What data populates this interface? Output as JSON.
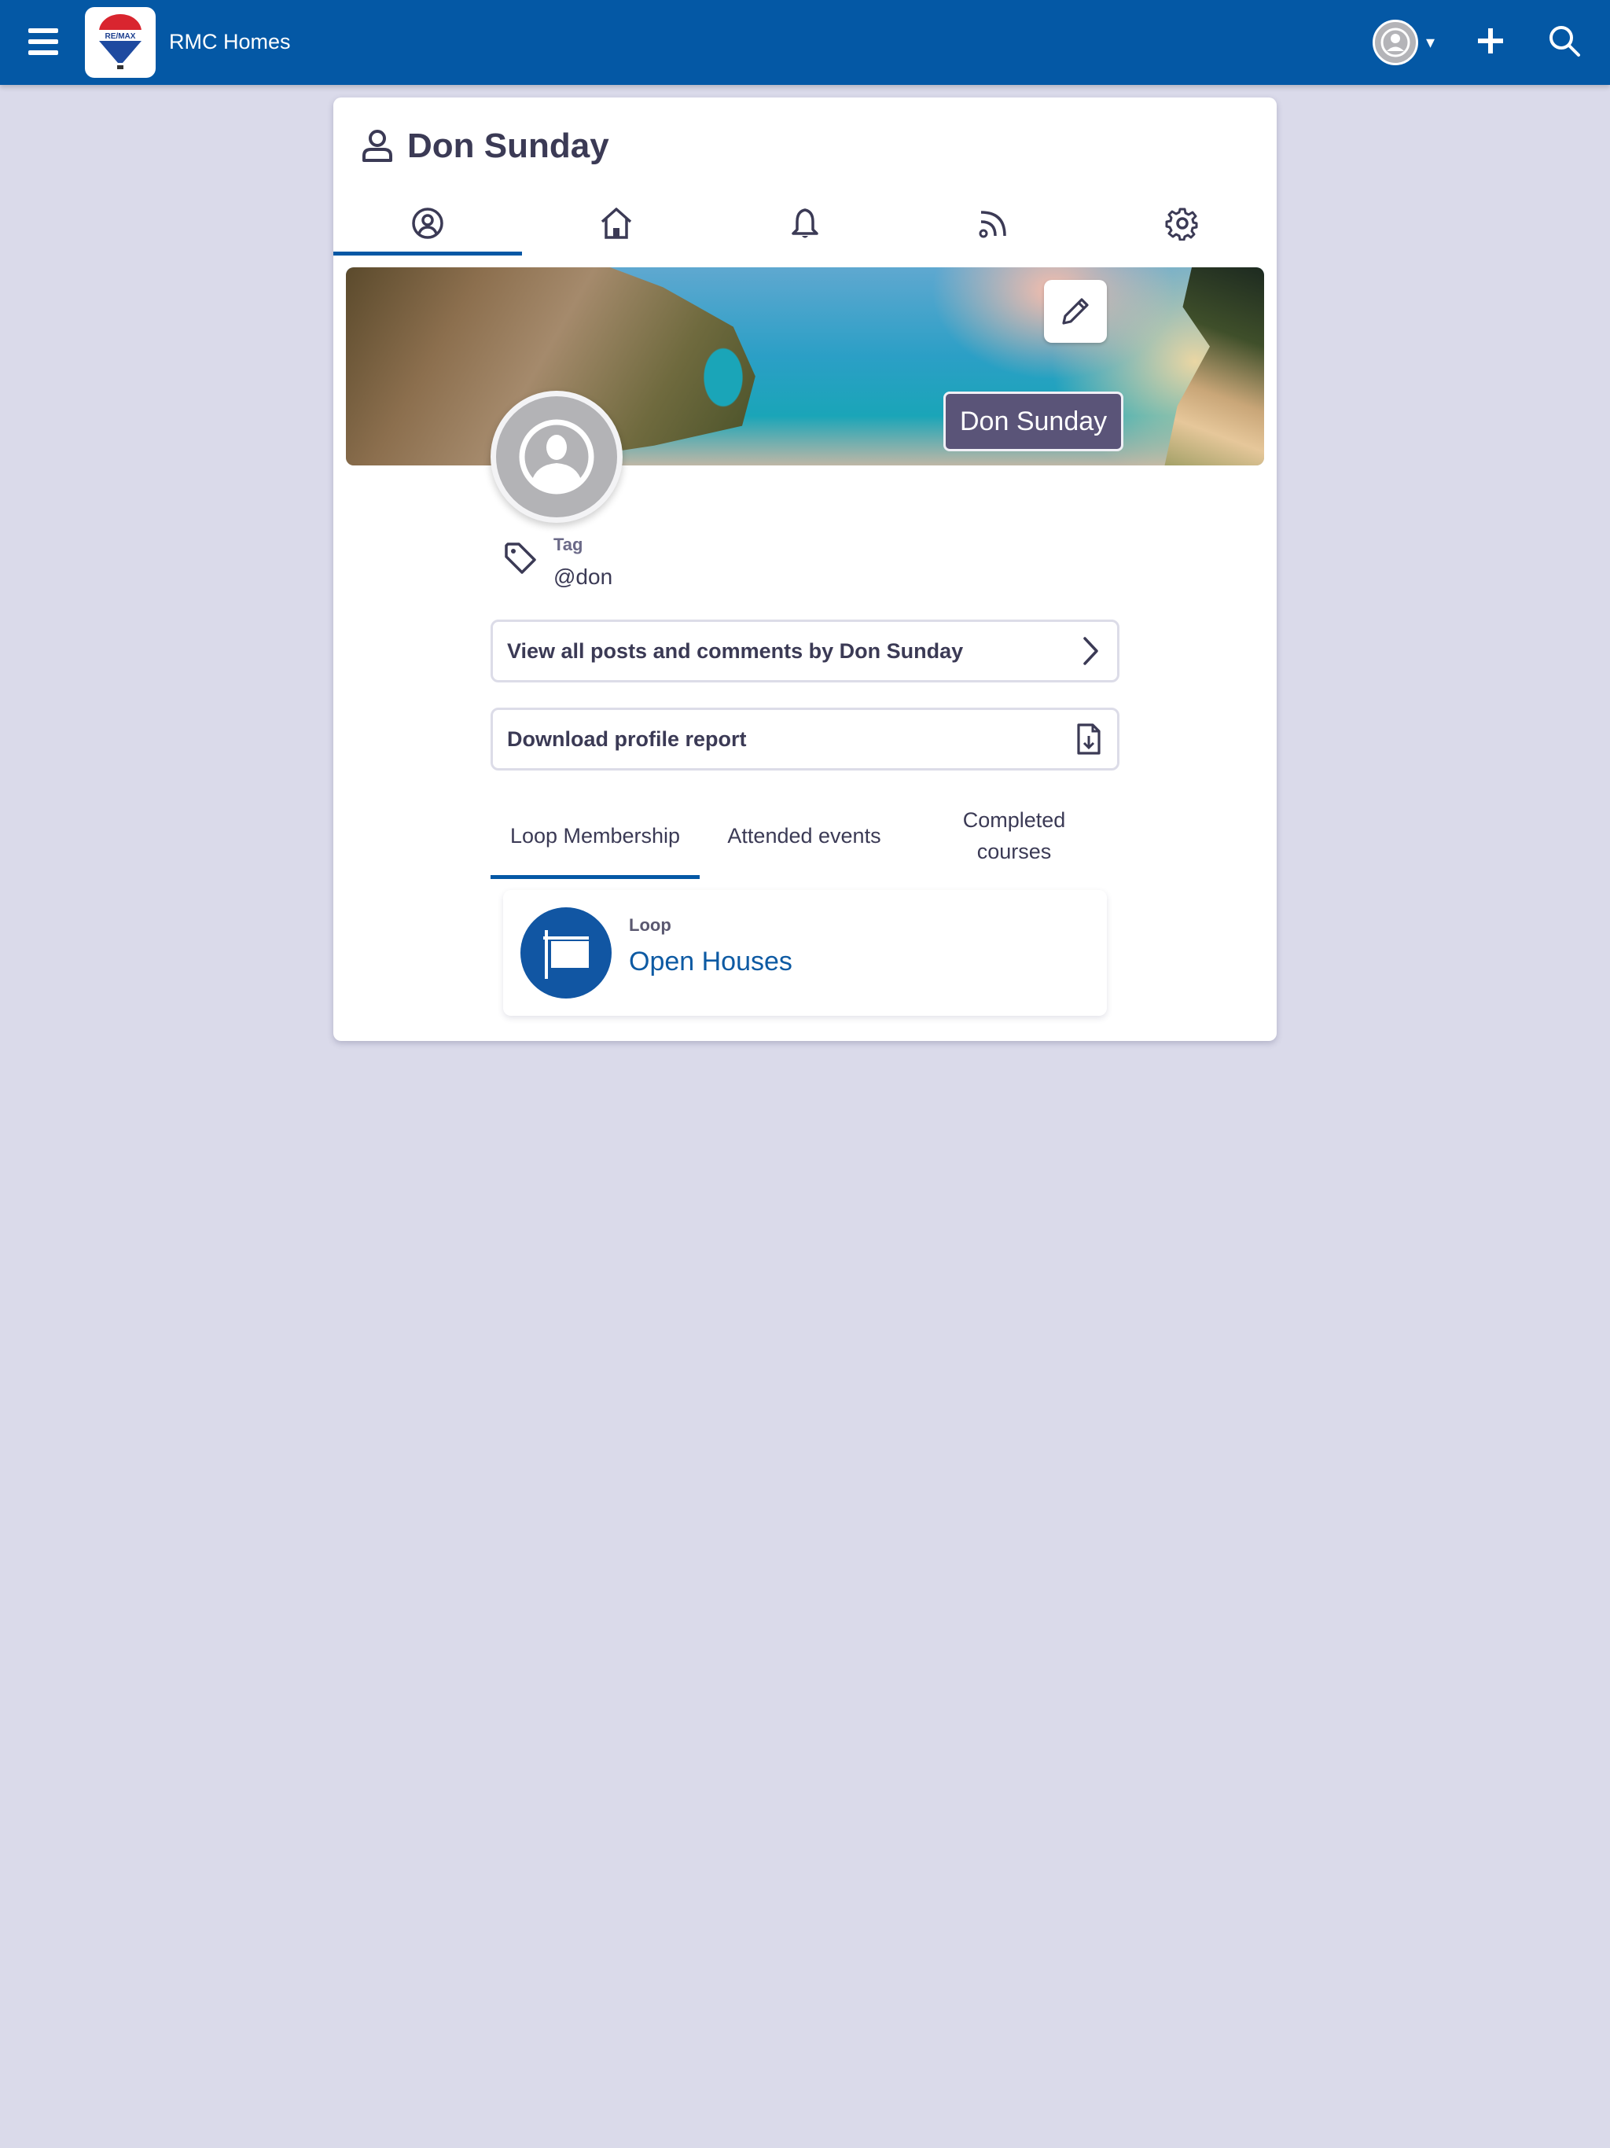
{
  "app": {
    "brand_name": "RMC Homes",
    "logo_text": "RE/MAX",
    "brand_color": "#0458a5",
    "background_color": "#dadaea"
  },
  "header": {
    "menu_icon": "hamburger-icon",
    "avatar_icon": "user-avatar-icon",
    "dropdown_caret": "▾",
    "add_icon": "plus-icon",
    "search_icon": "search-icon"
  },
  "profile": {
    "title": "Don Sunday",
    "title_icon": "user-icon",
    "icon_tabs": [
      {
        "name": "profile",
        "icon": "user-circle-icon",
        "active": true
      },
      {
        "name": "home",
        "icon": "home-icon",
        "active": false
      },
      {
        "name": "notifications",
        "icon": "bell-icon",
        "active": false
      },
      {
        "name": "feed",
        "icon": "rss-icon",
        "active": false
      },
      {
        "name": "settings",
        "icon": "gear-icon",
        "active": false
      }
    ],
    "banner": {
      "edit_icon": "pencil-icon",
      "name_badge": "Don Sunday"
    },
    "tag": {
      "label": "Tag",
      "value": "@don"
    },
    "actions": {
      "view_posts": "View all posts and comments by Don Sunday",
      "download_report": "Download profile report"
    },
    "content_tabs": [
      {
        "label": "Loop Membership",
        "active": true
      },
      {
        "label": "Attended events",
        "active": false
      },
      {
        "label": "Completed courses",
        "active": false
      }
    ],
    "loops": [
      {
        "label": "Loop",
        "name": "Open Houses",
        "icon": "sign-icon",
        "color": "#1156a3"
      }
    ]
  }
}
